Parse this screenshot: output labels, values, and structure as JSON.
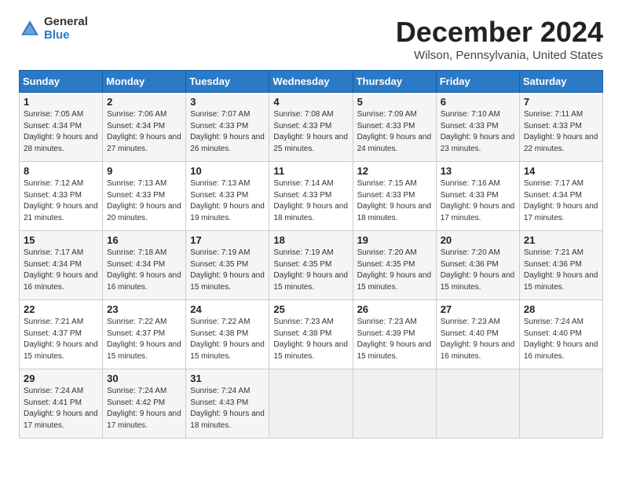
{
  "logo": {
    "general": "General",
    "blue": "Blue"
  },
  "title": "December 2024",
  "location": "Wilson, Pennsylvania, United States",
  "days_of_week": [
    "Sunday",
    "Monday",
    "Tuesday",
    "Wednesday",
    "Thursday",
    "Friday",
    "Saturday"
  ],
  "weeks": [
    [
      {
        "day": "1",
        "sunrise": "Sunrise: 7:05 AM",
        "sunset": "Sunset: 4:34 PM",
        "daylight": "Daylight: 9 hours and 28 minutes."
      },
      {
        "day": "2",
        "sunrise": "Sunrise: 7:06 AM",
        "sunset": "Sunset: 4:34 PM",
        "daylight": "Daylight: 9 hours and 27 minutes."
      },
      {
        "day": "3",
        "sunrise": "Sunrise: 7:07 AM",
        "sunset": "Sunset: 4:33 PM",
        "daylight": "Daylight: 9 hours and 26 minutes."
      },
      {
        "day": "4",
        "sunrise": "Sunrise: 7:08 AM",
        "sunset": "Sunset: 4:33 PM",
        "daylight": "Daylight: 9 hours and 25 minutes."
      },
      {
        "day": "5",
        "sunrise": "Sunrise: 7:09 AM",
        "sunset": "Sunset: 4:33 PM",
        "daylight": "Daylight: 9 hours and 24 minutes."
      },
      {
        "day": "6",
        "sunrise": "Sunrise: 7:10 AM",
        "sunset": "Sunset: 4:33 PM",
        "daylight": "Daylight: 9 hours and 23 minutes."
      },
      {
        "day": "7",
        "sunrise": "Sunrise: 7:11 AM",
        "sunset": "Sunset: 4:33 PM",
        "daylight": "Daylight: 9 hours and 22 minutes."
      }
    ],
    [
      {
        "day": "8",
        "sunrise": "Sunrise: 7:12 AM",
        "sunset": "Sunset: 4:33 PM",
        "daylight": "Daylight: 9 hours and 21 minutes."
      },
      {
        "day": "9",
        "sunrise": "Sunrise: 7:13 AM",
        "sunset": "Sunset: 4:33 PM",
        "daylight": "Daylight: 9 hours and 20 minutes."
      },
      {
        "day": "10",
        "sunrise": "Sunrise: 7:13 AM",
        "sunset": "Sunset: 4:33 PM",
        "daylight": "Daylight: 9 hours and 19 minutes."
      },
      {
        "day": "11",
        "sunrise": "Sunrise: 7:14 AM",
        "sunset": "Sunset: 4:33 PM",
        "daylight": "Daylight: 9 hours and 18 minutes."
      },
      {
        "day": "12",
        "sunrise": "Sunrise: 7:15 AM",
        "sunset": "Sunset: 4:33 PM",
        "daylight": "Daylight: 9 hours and 18 minutes."
      },
      {
        "day": "13",
        "sunrise": "Sunrise: 7:16 AM",
        "sunset": "Sunset: 4:33 PM",
        "daylight": "Daylight: 9 hours and 17 minutes."
      },
      {
        "day": "14",
        "sunrise": "Sunrise: 7:17 AM",
        "sunset": "Sunset: 4:34 PM",
        "daylight": "Daylight: 9 hours and 17 minutes."
      }
    ],
    [
      {
        "day": "15",
        "sunrise": "Sunrise: 7:17 AM",
        "sunset": "Sunset: 4:34 PM",
        "daylight": "Daylight: 9 hours and 16 minutes."
      },
      {
        "day": "16",
        "sunrise": "Sunrise: 7:18 AM",
        "sunset": "Sunset: 4:34 PM",
        "daylight": "Daylight: 9 hours and 16 minutes."
      },
      {
        "day": "17",
        "sunrise": "Sunrise: 7:19 AM",
        "sunset": "Sunset: 4:35 PM",
        "daylight": "Daylight: 9 hours and 15 minutes."
      },
      {
        "day": "18",
        "sunrise": "Sunrise: 7:19 AM",
        "sunset": "Sunset: 4:35 PM",
        "daylight": "Daylight: 9 hours and 15 minutes."
      },
      {
        "day": "19",
        "sunrise": "Sunrise: 7:20 AM",
        "sunset": "Sunset: 4:35 PM",
        "daylight": "Daylight: 9 hours and 15 minutes."
      },
      {
        "day": "20",
        "sunrise": "Sunrise: 7:20 AM",
        "sunset": "Sunset: 4:36 PM",
        "daylight": "Daylight: 9 hours and 15 minutes."
      },
      {
        "day": "21",
        "sunrise": "Sunrise: 7:21 AM",
        "sunset": "Sunset: 4:36 PM",
        "daylight": "Daylight: 9 hours and 15 minutes."
      }
    ],
    [
      {
        "day": "22",
        "sunrise": "Sunrise: 7:21 AM",
        "sunset": "Sunset: 4:37 PM",
        "daylight": "Daylight: 9 hours and 15 minutes."
      },
      {
        "day": "23",
        "sunrise": "Sunrise: 7:22 AM",
        "sunset": "Sunset: 4:37 PM",
        "daylight": "Daylight: 9 hours and 15 minutes."
      },
      {
        "day": "24",
        "sunrise": "Sunrise: 7:22 AM",
        "sunset": "Sunset: 4:38 PM",
        "daylight": "Daylight: 9 hours and 15 minutes."
      },
      {
        "day": "25",
        "sunrise": "Sunrise: 7:23 AM",
        "sunset": "Sunset: 4:38 PM",
        "daylight": "Daylight: 9 hours and 15 minutes."
      },
      {
        "day": "26",
        "sunrise": "Sunrise: 7:23 AM",
        "sunset": "Sunset: 4:39 PM",
        "daylight": "Daylight: 9 hours and 15 minutes."
      },
      {
        "day": "27",
        "sunrise": "Sunrise: 7:23 AM",
        "sunset": "Sunset: 4:40 PM",
        "daylight": "Daylight: 9 hours and 16 minutes."
      },
      {
        "day": "28",
        "sunrise": "Sunrise: 7:24 AM",
        "sunset": "Sunset: 4:40 PM",
        "daylight": "Daylight: 9 hours and 16 minutes."
      }
    ],
    [
      {
        "day": "29",
        "sunrise": "Sunrise: 7:24 AM",
        "sunset": "Sunset: 4:41 PM",
        "daylight": "Daylight: 9 hours and 17 minutes."
      },
      {
        "day": "30",
        "sunrise": "Sunrise: 7:24 AM",
        "sunset": "Sunset: 4:42 PM",
        "daylight": "Daylight: 9 hours and 17 minutes."
      },
      {
        "day": "31",
        "sunrise": "Sunrise: 7:24 AM",
        "sunset": "Sunset: 4:43 PM",
        "daylight": "Daylight: 9 hours and 18 minutes."
      },
      null,
      null,
      null,
      null
    ]
  ]
}
